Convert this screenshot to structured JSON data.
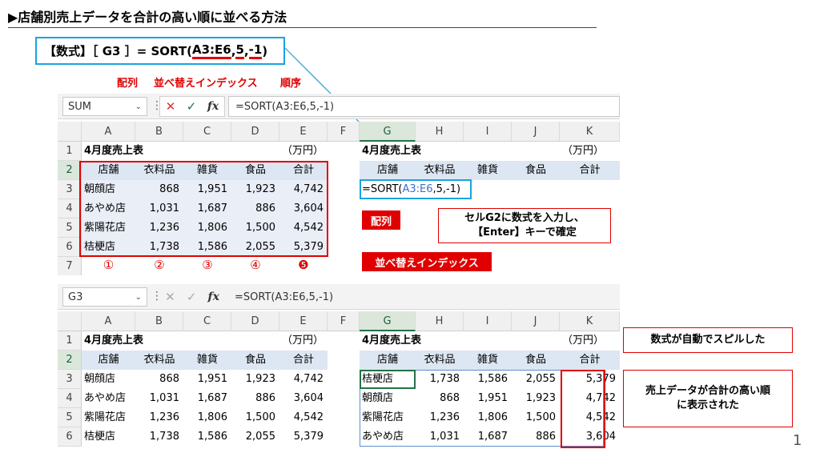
{
  "title": "▶店舗別売上データを合計の高い順に並べる方法",
  "formula": {
    "prefix": "【数式】［ G3 ］= SORT(",
    "arg1": "A3:E6",
    "sep1": ", ",
    "arg2": "5",
    "sep2": ", ",
    "arg3": "-1",
    "suffix": ")"
  },
  "arg_labels": {
    "array": "配列",
    "sort_index": "並べ替えインデックス",
    "order": "順序"
  },
  "top_excel": {
    "namebox": "SUM",
    "formula_bar": "=SORT(A3:E6,5,-1)",
    "cancel_icon": "✕",
    "enter_icon": "✓",
    "fx_icon": "fx",
    "g3_prefix": "=SORT(",
    "g3_ref": "A3:E6",
    "g3_suffix": ",5,-1)"
  },
  "bottom_excel": {
    "namebox": "G3",
    "formula_bar": "=SORT(A3:E6,5,-1)",
    "cancel_icon": "✕",
    "enter_icon": "✓",
    "fx_icon": "fx"
  },
  "columns": [
    "A",
    "B",
    "C",
    "D",
    "E",
    "F",
    "G",
    "H",
    "I",
    "J",
    "K"
  ],
  "rows": [
    "1",
    "2",
    "3",
    "4",
    "5",
    "6",
    "7"
  ],
  "table_title": "4月度売上表",
  "unit": "（万円）",
  "headers": [
    "店舗",
    "衣料品",
    "雑貨",
    "食品",
    "合計"
  ],
  "source_data": [
    [
      "朝顔店",
      "868",
      "1,951",
      "1,923",
      "4,742"
    ],
    [
      "あやめ店",
      "1,031",
      "1,687",
      "886",
      "3,604"
    ],
    [
      "紫陽花店",
      "1,236",
      "1,806",
      "1,500",
      "4,542"
    ],
    [
      "桔梗店",
      "1,738",
      "1,586",
      "2,055",
      "5,379"
    ]
  ],
  "sorted_data": [
    [
      "桔梗店",
      "1,738",
      "1,586",
      "2,055",
      "5,379"
    ],
    [
      "朝顔店",
      "868",
      "1,951",
      "1,923",
      "4,742"
    ],
    [
      "紫陽花店",
      "1,236",
      "1,806",
      "1,500",
      "4,542"
    ],
    [
      "あやめ店",
      "1,031",
      "1,687",
      "886",
      "3,604"
    ]
  ],
  "index_markers": [
    "①",
    "②",
    "③",
    "④",
    "❺"
  ],
  "callouts": {
    "array": "配列",
    "sort_index": "並べ替えインデックス",
    "instruction_line1": "セルG2に数式を入力し、",
    "instruction_line2": "【Enter】キーで確定",
    "spill": "数式が自動でスピルした",
    "result_line1": "売上データが合計の高い順",
    "result_line2": "に表示された"
  },
  "page_number": "1",
  "colors": {
    "accent_red": "#e00000",
    "accent_blue": "#1aa3e0",
    "excel_green": "#217346"
  }
}
